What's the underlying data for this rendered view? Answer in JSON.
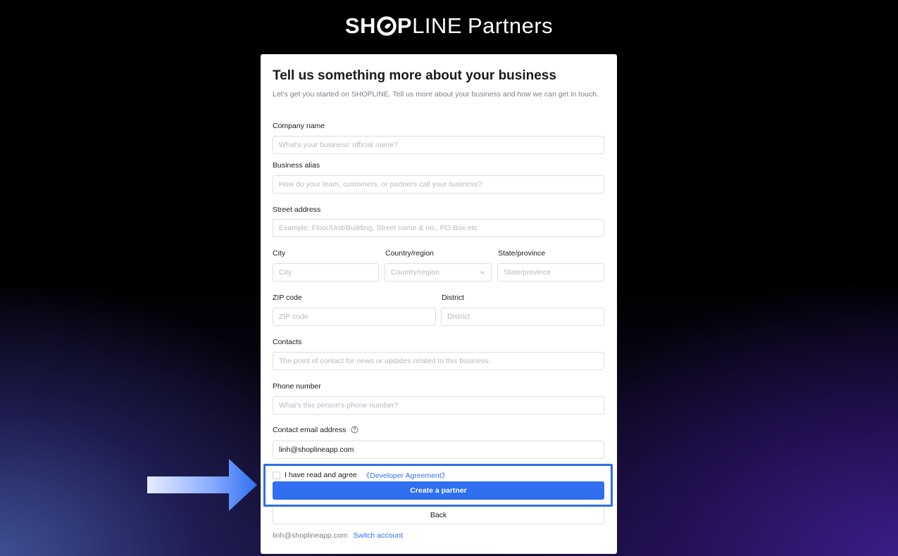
{
  "brand": {
    "logo_part1": "SH",
    "logo_part2": "P",
    "logo_part3": "LINE",
    "logo_suffix": "Partners"
  },
  "form": {
    "title": "Tell us something more about your business",
    "subtitle": "Let's get you started on SHOPLINE. Tell us more about your business and how we can get in touch.",
    "company_name": {
      "label": "Company name",
      "placeholder": "What's your business' official name?"
    },
    "business_alias": {
      "label": "Business alias",
      "placeholder": "How do your team, customers, or partners call your business?"
    },
    "street_address": {
      "label": "Street address",
      "placeholder": "Example: Floor/Unit/Building, Street name & no., PO Box etc"
    },
    "city": {
      "label": "City",
      "placeholder": "City"
    },
    "country": {
      "label": "Country/region",
      "placeholder": "Country/region"
    },
    "state": {
      "label": "State/province",
      "placeholder": "State/province"
    },
    "zip": {
      "label": "ZIP code",
      "placeholder": "ZIP code"
    },
    "district": {
      "label": "District",
      "placeholder": "District"
    },
    "contacts": {
      "label": "Contacts",
      "placeholder": "The point of contact for news or updates related to this business."
    },
    "phone": {
      "label": "Phone number",
      "placeholder": "What's this person's phone number?"
    },
    "email": {
      "label": "Contact email address",
      "value": "linh@shoplineapp.com"
    },
    "agree_text": "I have read and agree",
    "agreement_link": "《Developer Agreement》",
    "submit_label": "Create a partner",
    "back_label": "Back"
  },
  "footer": {
    "account_email": "linh@shoplineapp.com",
    "switch_label": "Switch account"
  },
  "colors": {
    "accent": "#2f6ff0",
    "highlight": "#2f6ff0"
  },
  "icons": {
    "help": "question-circle-icon",
    "chevron": "chevron-down-icon",
    "arrow": "right-arrow-icon"
  }
}
